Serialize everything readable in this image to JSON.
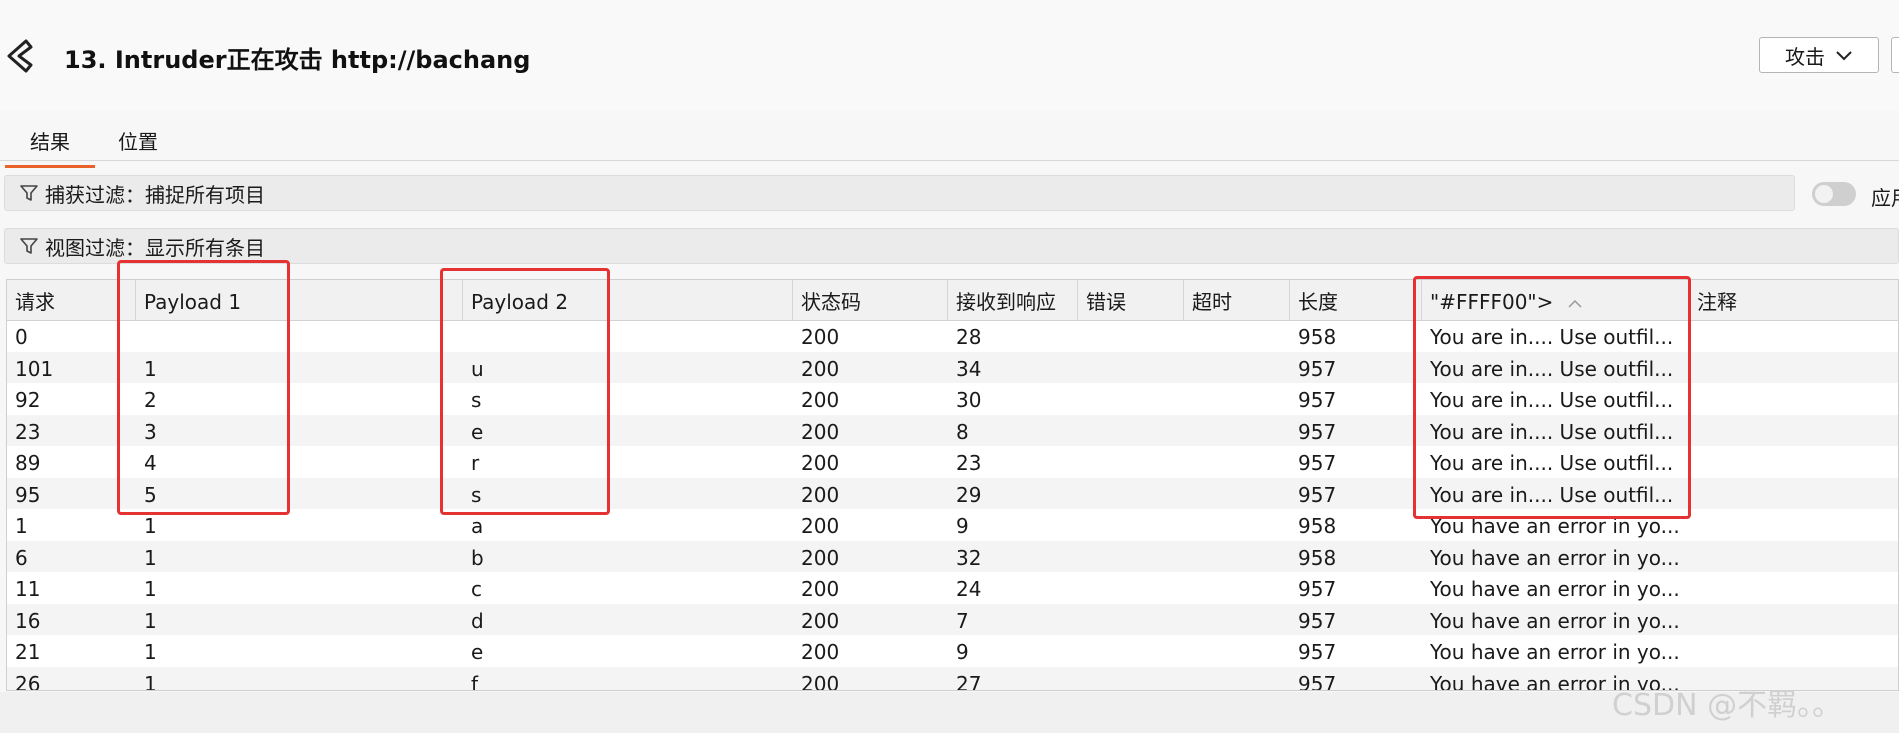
{
  "window": {
    "title": "13. Intruder正在攻击 http://bachang",
    "attack_button": "攻击"
  },
  "tabs": [
    {
      "label": "结果"
    },
    {
      "label": "位置"
    }
  ],
  "filters": {
    "capture": "捕获过滤：捕捉所有项目",
    "view": "视图过滤：显示所有条目",
    "toggle_label": "应用"
  },
  "table": {
    "columns": [
      "请求",
      "Payload 1",
      "Payload 2",
      "状态码",
      "接收到响应",
      "错误",
      "超时",
      "长度",
      "\"#FFFF00\">",
      "注释"
    ],
    "rows": [
      [
        "0",
        "",
        "",
        "200",
        "28",
        "",
        "",
        "958",
        "You are in.... Use outfil...",
        ""
      ],
      [
        "101",
        "1",
        "u",
        "200",
        "34",
        "",
        "",
        "957",
        "You are in.... Use outfil...",
        ""
      ],
      [
        "92",
        "2",
        "s",
        "200",
        "30",
        "",
        "",
        "957",
        "You are in.... Use outfil...",
        ""
      ],
      [
        "23",
        "3",
        "e",
        "200",
        "8",
        "",
        "",
        "957",
        "You are in.... Use outfil...",
        ""
      ],
      [
        "89",
        "4",
        "r",
        "200",
        "23",
        "",
        "",
        "957",
        "You are in.... Use outfil...",
        ""
      ],
      [
        "95",
        "5",
        "s",
        "200",
        "29",
        "",
        "",
        "957",
        "You are in.... Use outfil...",
        ""
      ],
      [
        "1",
        "1",
        "a",
        "200",
        "9",
        "",
        "",
        "958",
        "You have an error in yo...",
        ""
      ],
      [
        "6",
        "1",
        "b",
        "200",
        "32",
        "",
        "",
        "958",
        "You have an error in yo...",
        ""
      ],
      [
        "11",
        "1",
        "c",
        "200",
        "24",
        "",
        "",
        "957",
        "You have an error in yo...",
        ""
      ],
      [
        "16",
        "1",
        "d",
        "200",
        "7",
        "",
        "",
        "957",
        "You have an error in yo...",
        ""
      ],
      [
        "21",
        "1",
        "e",
        "200",
        "9",
        "",
        "",
        "957",
        "You have an error in yo...",
        ""
      ],
      [
        "26",
        "1",
        "f",
        "200",
        "27",
        "",
        "",
        "957",
        "You have an error in yo...",
        ""
      ]
    ]
  },
  "watermark": "CSDN @不羁。。",
  "colors": {
    "accent": "#e8622a",
    "highlight": "#e53333"
  }
}
